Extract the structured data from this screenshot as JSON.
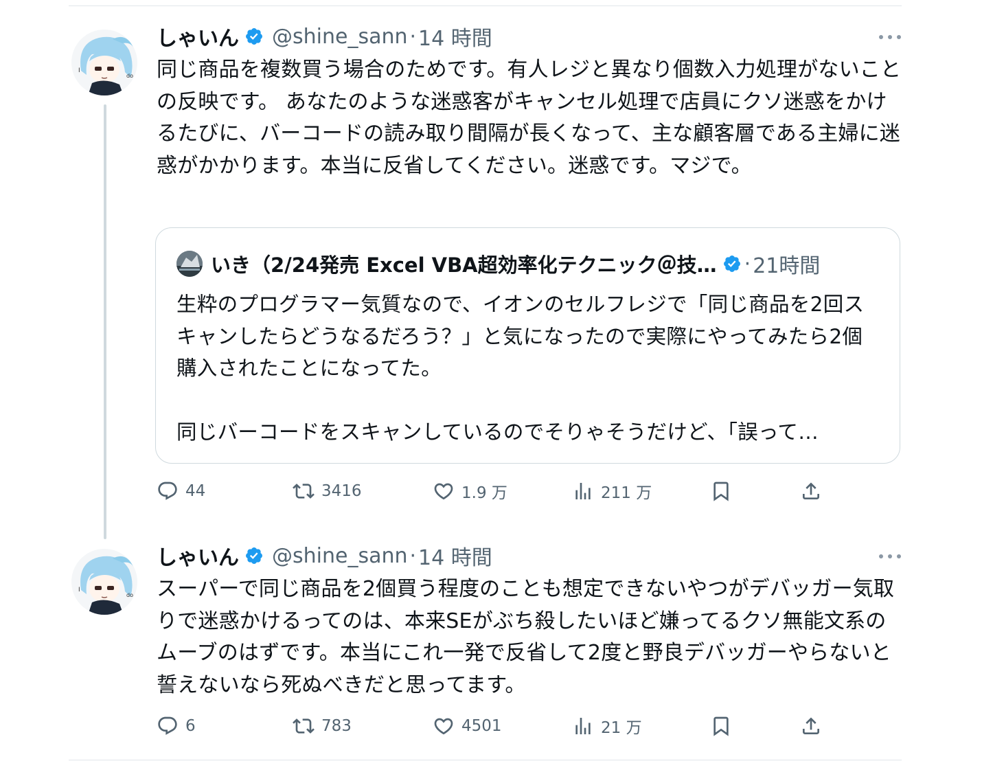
{
  "tweets": [
    {
      "author_name": "しゃいん",
      "handle": "@shine_sann",
      "separator": "·",
      "time": "14 時間",
      "text": "同じ商品を複数買う場合のためです。有人レジと異なり個数入力処理がないことの反映です。 あなたのような迷惑客がキャンセル処理で店員にクソ迷惑をかけるたびに、バーコードの読み取り間隔が長くなって、主な顧客層である主婦に迷惑がかかります。本当に反省してください。迷惑です。マジで。",
      "quoted": {
        "author_name": "いき（2/24発売 Excel VBA超効率化テクニック＠技…",
        "separator": "·",
        "time": "21時間",
        "text": "生粋のプログラマー気質なので、イオンのセルフレジで「同じ商品を2回スキャンしたらどうなるだろう？」と気になったので実際にやってみたら2個購入されたことになってた。\n\n同じバーコードをスキャンしているのでそりゃそうだけど、「誤って…"
      },
      "stats": {
        "replies": "44",
        "retweets": "3416",
        "likes": "1.9 万",
        "views": "211 万"
      }
    },
    {
      "author_name": "しゃいん",
      "handle": "@shine_sann",
      "separator": "·",
      "time": "14 時間",
      "text": "スーパーで同じ商品を2個買う程度のことも想定できないやつがデバッガー気取りで迷惑かけるってのは、本来SEがぶち殺したいほど嫌ってるクソ無能文系のムーブのはずです。本当にこれ一発で反省して2度と野良デバッガーやらないと誓えないなら死ぬべきだと思ってます。",
      "stats": {
        "replies": "6",
        "retweets": "783",
        "likes": "4501",
        "views": "21 万"
      }
    }
  ],
  "colors": {
    "text": "#0f1419",
    "secondary": "#536471",
    "verified": "#1d9bf0",
    "border": "#cfd9de"
  },
  "icons": [
    "verified-badge-icon",
    "more-icon",
    "reply-icon",
    "retweet-icon",
    "like-icon",
    "views-icon",
    "bookmark-icon",
    "share-icon"
  ]
}
